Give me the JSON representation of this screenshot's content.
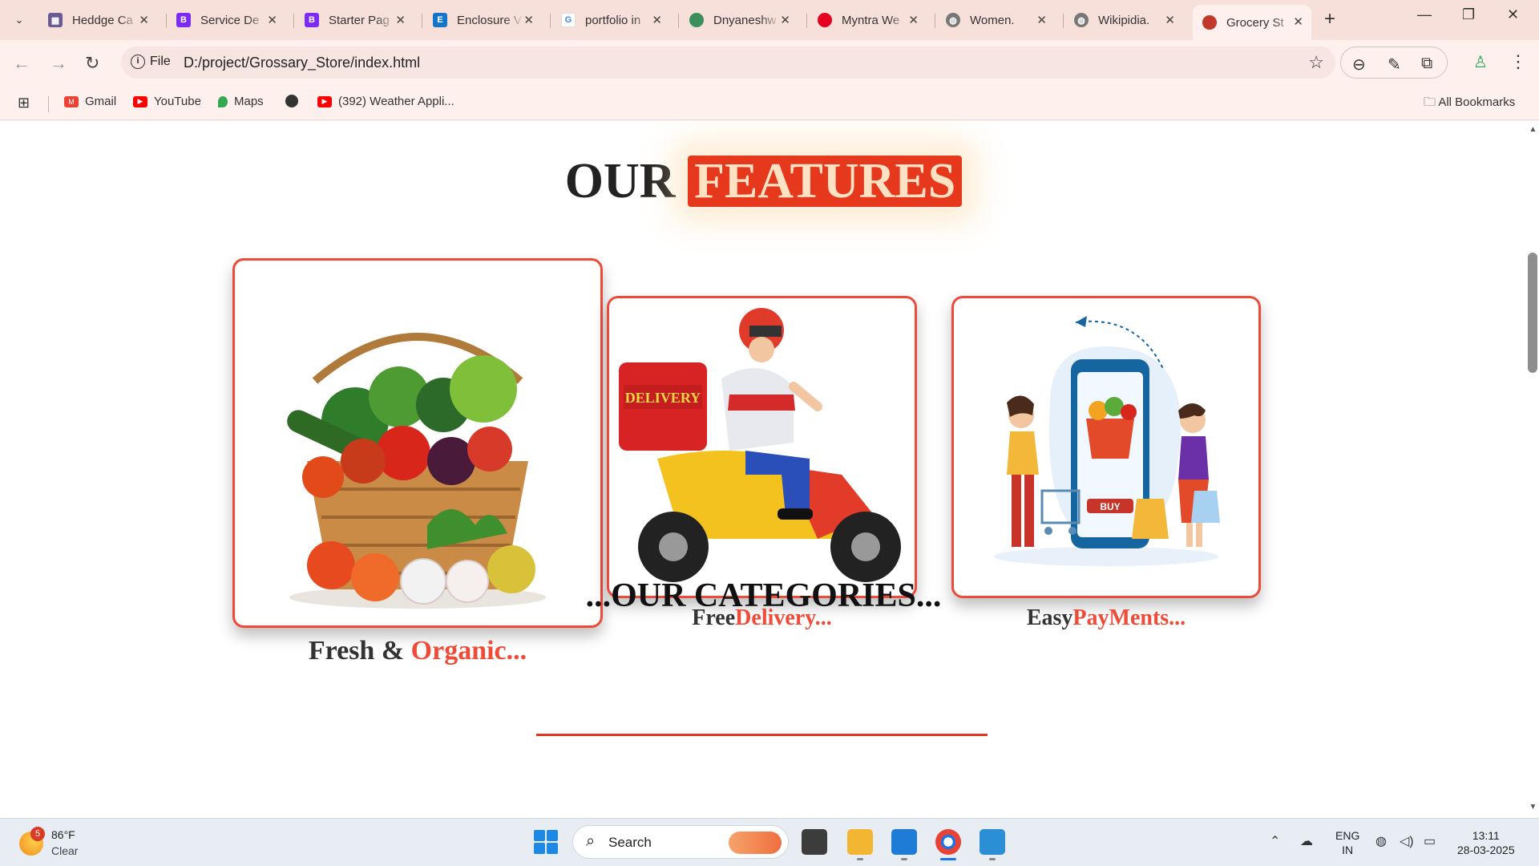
{
  "browser": {
    "tabs": [
      {
        "title": "Heddge Ca",
        "icon": "image-favicon",
        "color": "#6b5b95"
      },
      {
        "title": "Service De",
        "icon": "bootstrap-favicon",
        "color": "#7b2cf0"
      },
      {
        "title": "Starter Pag",
        "icon": "bootstrap-favicon",
        "color": "#7b2cf0"
      },
      {
        "title": "Enclosure V",
        "icon": "enclosure-favicon",
        "color": "#1576c9"
      },
      {
        "title": "portfolio in",
        "icon": "google-favicon",
        "color": "#4285f4"
      },
      {
        "title": "Dnyaneshw",
        "icon": "site-favicon",
        "color": "#3a8f5c"
      },
      {
        "title": "Myntra We",
        "icon": "red-dot-favicon",
        "color": "#e6001f"
      },
      {
        "title": "Women.",
        "icon": "globe-favicon",
        "color": "#666666"
      },
      {
        "title": "Wikipidia.",
        "icon": "globe-favicon",
        "color": "#666666"
      },
      {
        "title": "Grocery St",
        "icon": "grocery-favicon",
        "color": "#c0392b",
        "active": true
      }
    ],
    "omnibox": {
      "scheme_label": "File",
      "url": "D:/project/Grossary_Store/index.html"
    },
    "bookmarks": [
      {
        "label": "Gmail",
        "icon": "gmail-icon",
        "color": "#ea4335"
      },
      {
        "label": "YouTube",
        "icon": "youtube-icon",
        "color": "#ff0000"
      },
      {
        "label": "Maps",
        "icon": "maps-icon",
        "color": "#34a853"
      },
      {
        "label": "",
        "icon": "globe-icon",
        "color": "#333333"
      },
      {
        "label": "(392) Weather Appli...",
        "icon": "youtube-icon",
        "color": "#ff0000"
      }
    ],
    "all_bookmarks_label": "All Bookmarks"
  },
  "page": {
    "features_title": {
      "plain": "OUR",
      "highlight": "FEATURES"
    },
    "features": [
      {
        "caption_plain": "Fresh   & ",
        "caption_accent": "Organic...",
        "image": "vegetable-basket"
      },
      {
        "caption_plain": "Free",
        "caption_accent": "Delivery...",
        "image": "delivery-scooter"
      },
      {
        "caption_plain": "Easy",
        "caption_accent": "PayMents...",
        "image": "mobile-shopping"
      }
    ],
    "categories_title": "...OUR CATEGORIES...",
    "accent_color": "#e5381d"
  },
  "taskbar": {
    "weather": {
      "badge": "5",
      "temp": "86°F",
      "condition": "Clear"
    },
    "search_label": "Search",
    "language": {
      "line1": "ENG",
      "line2": "IN"
    },
    "clock": {
      "time": "13:11",
      "date": "28-03-2025"
    }
  }
}
